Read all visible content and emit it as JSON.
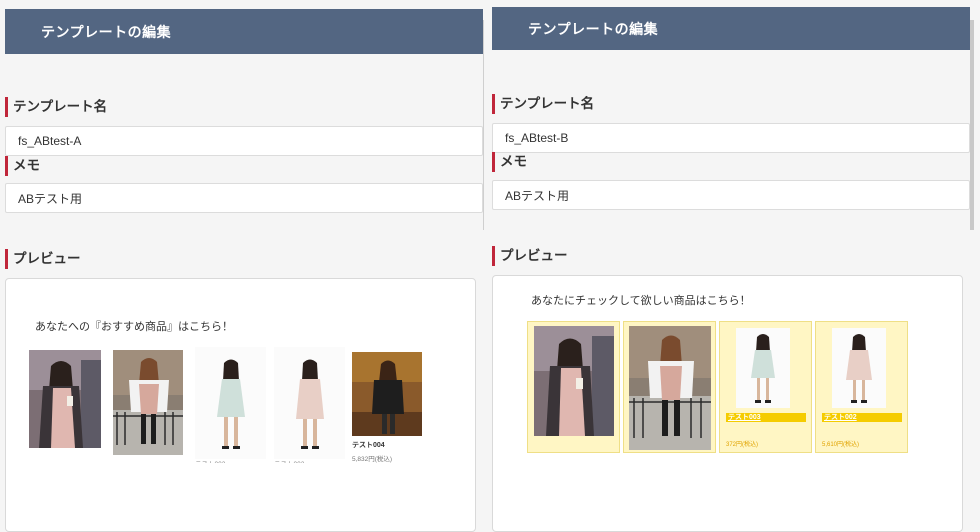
{
  "left": {
    "header": "テンプレートの編集",
    "template_name_label": "テンプレート名",
    "template_name_value": "fs_ABtest-A",
    "memo_label": "メモ",
    "memo_value": "ABテスト用",
    "preview_label": "プレビュー",
    "preview_heading": "あなたへの『おすすめ商品』はこちら！",
    "products": [
      {
        "name": "",
        "price": ""
      },
      {
        "name": "",
        "price": ""
      },
      {
        "name": "",
        "price": "",
        "cut_text": "テスト003"
      },
      {
        "name": "",
        "price": "",
        "cut_text": "テスト002"
      },
      {
        "name": "テスト004",
        "price": "5,832円(税込)"
      }
    ]
  },
  "right": {
    "header": "テンプレートの編集",
    "template_name_label": "テンプレート名",
    "template_name_value": "fs_ABtest-B",
    "memo_label": "メモ",
    "memo_value": "ABテスト用",
    "preview_label": "プレビュー",
    "preview_heading": "あなたにチェックして欲しい商品はこちら！",
    "products": [
      {
        "name": "",
        "price": ""
      },
      {
        "name": "",
        "price": ""
      },
      {
        "name": "テスト003",
        "price": "372円(税込)"
      },
      {
        "name": "テスト002",
        "price": "5,610円(税込)"
      }
    ]
  },
  "colors": {
    "header_bg": "#536682",
    "label_accent": "#c0263a",
    "highlight_bg": "#fff6c4",
    "highlight_name_bg": "#f5cc00"
  }
}
